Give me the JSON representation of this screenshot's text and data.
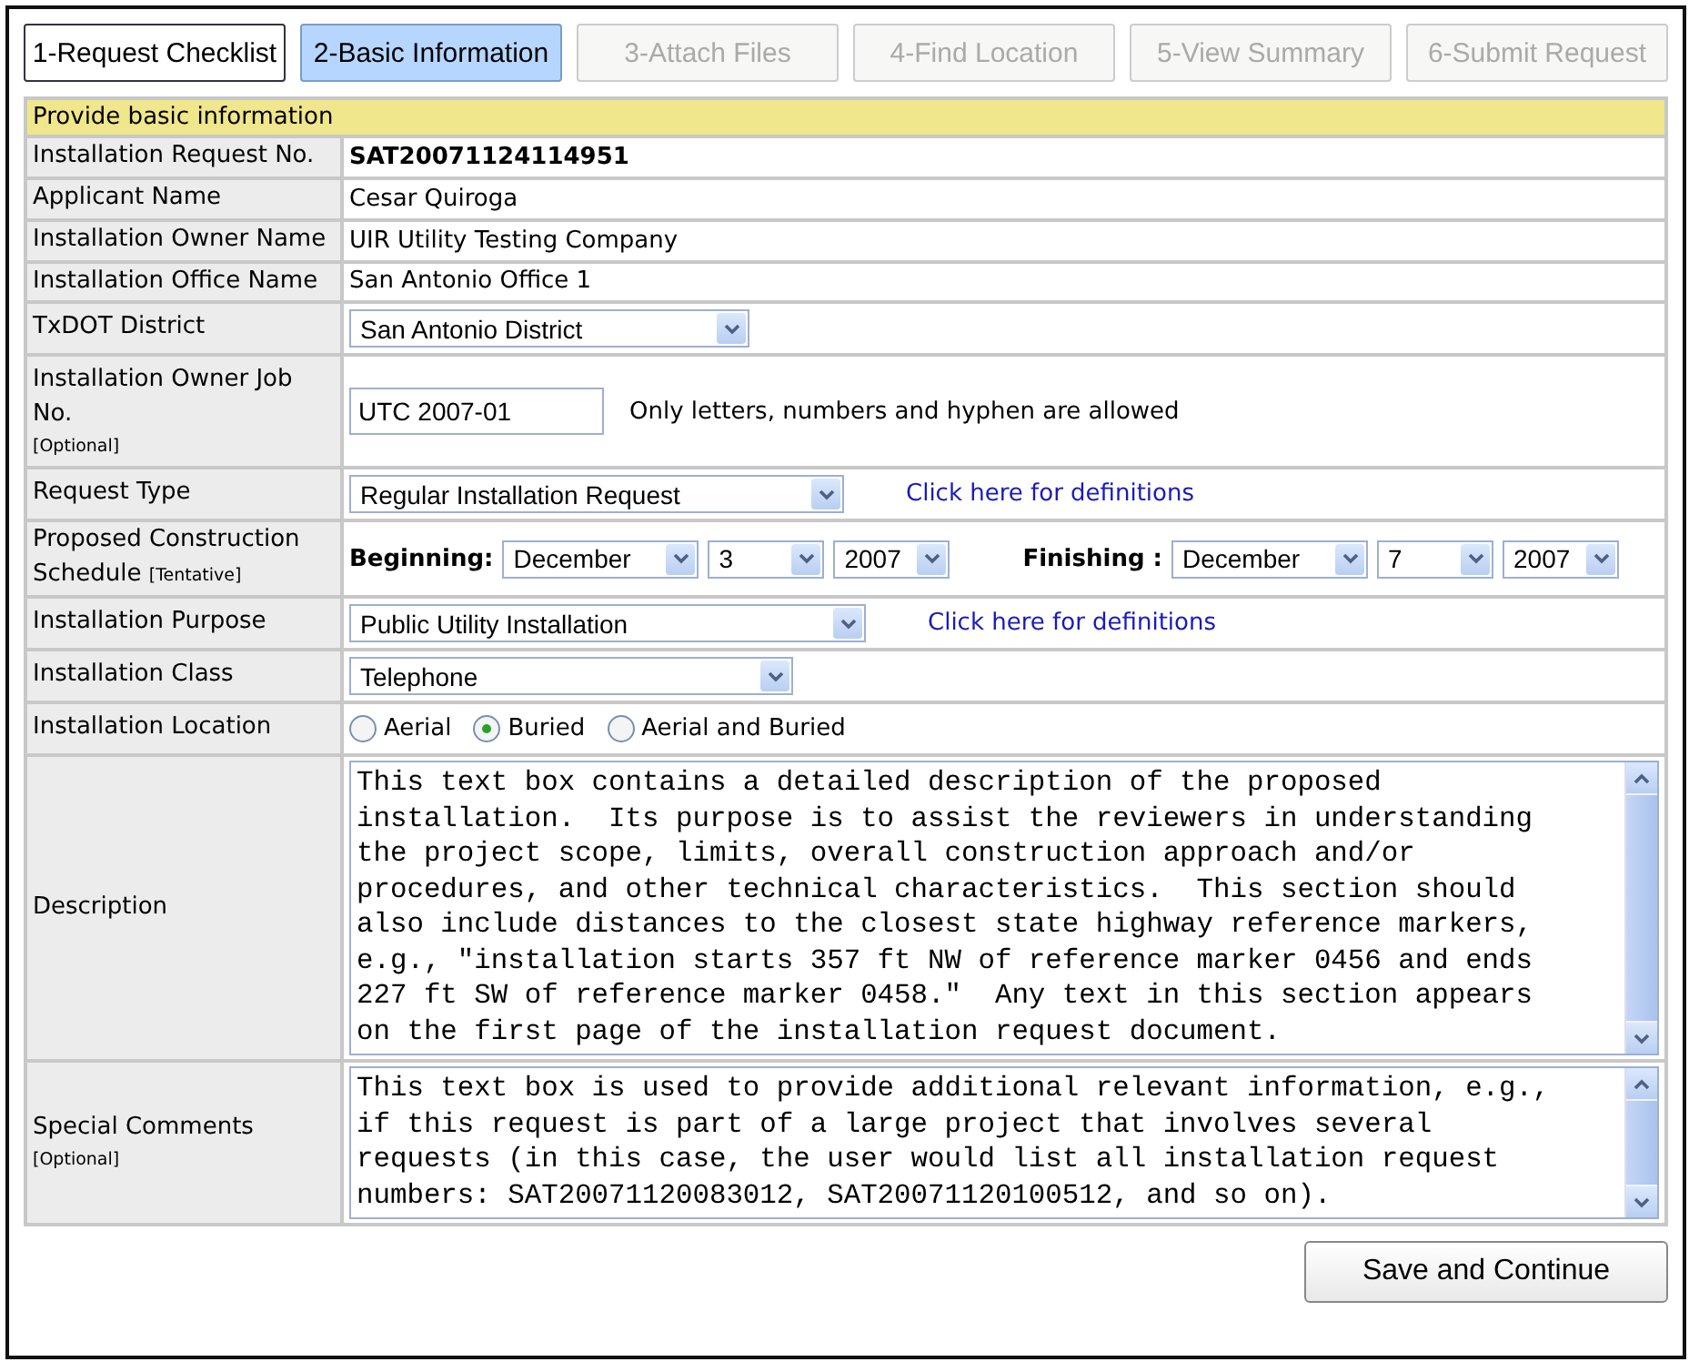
{
  "tabs": [
    {
      "label": "1-Request Checklist",
      "selected": false,
      "disabled": false
    },
    {
      "label": "2-Basic Information",
      "selected": true,
      "disabled": false
    },
    {
      "label": "3-Attach Files",
      "selected": false,
      "disabled": true
    },
    {
      "label": "4-Find Location",
      "selected": false,
      "disabled": true
    },
    {
      "label": "5-View Summary",
      "selected": false,
      "disabled": true
    },
    {
      "label": "6-Submit Request",
      "selected": false,
      "disabled": true
    }
  ],
  "form": {
    "title": "Provide basic information",
    "rows": [
      {
        "kind": "id",
        "label": "Installation Request No.",
        "value": "SAT20071124114951"
      },
      {
        "kind": "text",
        "label": "Applicant Name",
        "value": "Cesar Quiroga"
      },
      {
        "kind": "text",
        "label": "Installation Owner Name",
        "value": "UIR Utility Testing Company"
      },
      {
        "kind": "text",
        "label": "Installation Office Name",
        "value": "San Antonio Office 1"
      },
      {
        "kind": "select",
        "label": "TxDOT District",
        "value": "San Antonio District"
      },
      {
        "kind": "input",
        "label": "Installation Owner Job No.",
        "note": "[Optional]",
        "value": "UTC 2007-01",
        "hint": "Only letters, numbers and hyphen are allowed"
      },
      {
        "kind": "select",
        "label": "Request Type",
        "value": "Regular Installation Request",
        "link": "Click here for definitions"
      },
      {
        "kind": "schedule",
        "label": "Proposed Construction Schedule",
        "note": "[Tentative]",
        "groups": [
          {
            "label": "Beginning:",
            "month": "December",
            "day": "3",
            "year": "2007"
          },
          {
            "label": "Finishing :",
            "month": "December",
            "day": "7",
            "year": "2007"
          }
        ]
      },
      {
        "kind": "select",
        "label": "Installation Purpose",
        "value": "Public Utility Installation",
        "link": "Click here for definitions"
      },
      {
        "kind": "select",
        "label": "Installation Class",
        "value": "Telephone"
      },
      {
        "kind": "radio",
        "label": "Installation Location",
        "options": [
          {
            "label": "Aerial",
            "selected": false
          },
          {
            "label": "Buried",
            "selected": true
          },
          {
            "label": "Aerial and Buried",
            "selected": false
          }
        ]
      },
      {
        "kind": "textarea",
        "label": "Description",
        "value": "This text box contains a detailed description of the proposed\ninstallation.  Its purpose is to assist the reviewers in understanding\nthe project scope, limits, overall construction approach and/or\nprocedures, and other technical characteristics.  This section should\nalso include distances to the closest state highway reference markers,\ne.g., \"installation starts 357 ft NW of reference marker 0456 and ends\n227 ft SW of reference marker 0458.\"  Any text in this section appears\non the first page of the installation request document."
      },
      {
        "kind": "textarea",
        "label": "Special Comments",
        "note": "[Optional]",
        "value": "This text box is used to provide additional relevant information, e.g.,\nif this request is part of a large project that involves several\nrequests (in this case, the user would list all installation request\nnumbers: SAT20071120083012, SAT20071120100512, and so on)."
      }
    ]
  },
  "save_button": "Save and Continue"
}
